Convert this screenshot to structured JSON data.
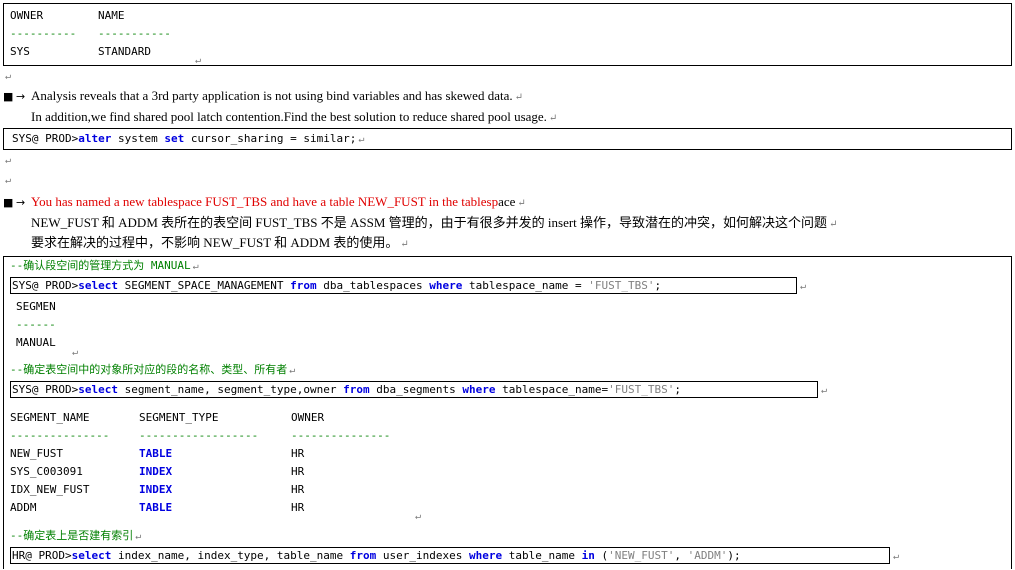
{
  "marks": {
    "para": "↵"
  },
  "box1": {
    "headers": [
      "OWNER",
      "NAME"
    ],
    "dashes": [
      "----------",
      "-----------"
    ],
    "row": [
      "SYS",
      "STANDARD"
    ]
  },
  "bullet_glyph": "■",
  "arrow_glyph": "→",
  "q1": {
    "line1": "Analysis reveals that a 3rd party application is not using bind variables and has skewed data.",
    "line2": "In addition,we find shared pool latch contention.Find the best solution to reduce shared pool usage."
  },
  "cmd1": {
    "prompt": "SYS@ PROD>",
    "kw1": "alter",
    "t1": " system ",
    "kw2": "set",
    "t2": " cursor_sharing = similar;"
  },
  "q2": {
    "title_red": "You has named a new tablespace FUST_TBS and have a table NEW_FUST in the tablesp",
    "title_black": "ace",
    "line2": "NEW_FUST 和 ADDM 表所在的表空间 FUST_TBS 不是 ASSM 管理的，由于有很多并发的 insert 操作，导致潜在的冲突，如何解决这个问题",
    "line3": "要求在解决的过程中，不影响 NEW_FUST 和 ADDM 表的使用。"
  },
  "box3": {
    "comment1": "--确认段空间的管理方式为 MANUAL",
    "cmd2": {
      "prompt": "SYS@ PROD>",
      "kw1": "select",
      "t1": " SEGMENT_SPACE_MANAGEMENT ",
      "kw2": "from",
      "t2": " dba_tablespaces ",
      "kw3": "where",
      "t3": " tablespace_name = ",
      "str": "'FUST_TBS'",
      "end": ";"
    },
    "res1": {
      "header": "SEGMEN",
      "dashes": "------",
      "value": "MANUAL"
    },
    "comment2": "--确定表空间中的对象所对应的段的名称、类型、所有者",
    "cmd3": {
      "prompt": "SYS@ PROD>",
      "kw1": "select",
      "t1": " segment_name, segment_type,owner ",
      "kw2": "from",
      "t2": " dba_segments ",
      "kw3": "where",
      "t3": " tablespace_name=",
      "str": "'FUST_TBS'",
      "end": ";"
    },
    "table": {
      "headers": [
        "SEGMENT_NAME",
        "SEGMENT_TYPE",
        "OWNER"
      ],
      "dashes": [
        "---------------",
        "------------------",
        "---------------"
      ],
      "rows": [
        [
          "NEW_FUST",
          "TABLE",
          "HR"
        ],
        [
          "SYS_C003091",
          "INDEX",
          "HR"
        ],
        [
          "IDX_NEW_FUST",
          "INDEX",
          "HR"
        ],
        [
          "ADDM",
          "TABLE",
          "HR"
        ]
      ]
    },
    "comment3": "--确定表上是否建有索引",
    "cmd4": {
      "prompt": "HR@ PROD>",
      "kw1": "select",
      "t1": " index_name, index_type, table_name ",
      "kw2": "from",
      "t2": " user_indexes ",
      "kw3": "where",
      "t3": " table_name ",
      "kw4": "in",
      "t4": " (",
      "str1": "'NEW_FUST'",
      "sep": ", ",
      "str2": "'ADDM'",
      "end": ");"
    }
  }
}
